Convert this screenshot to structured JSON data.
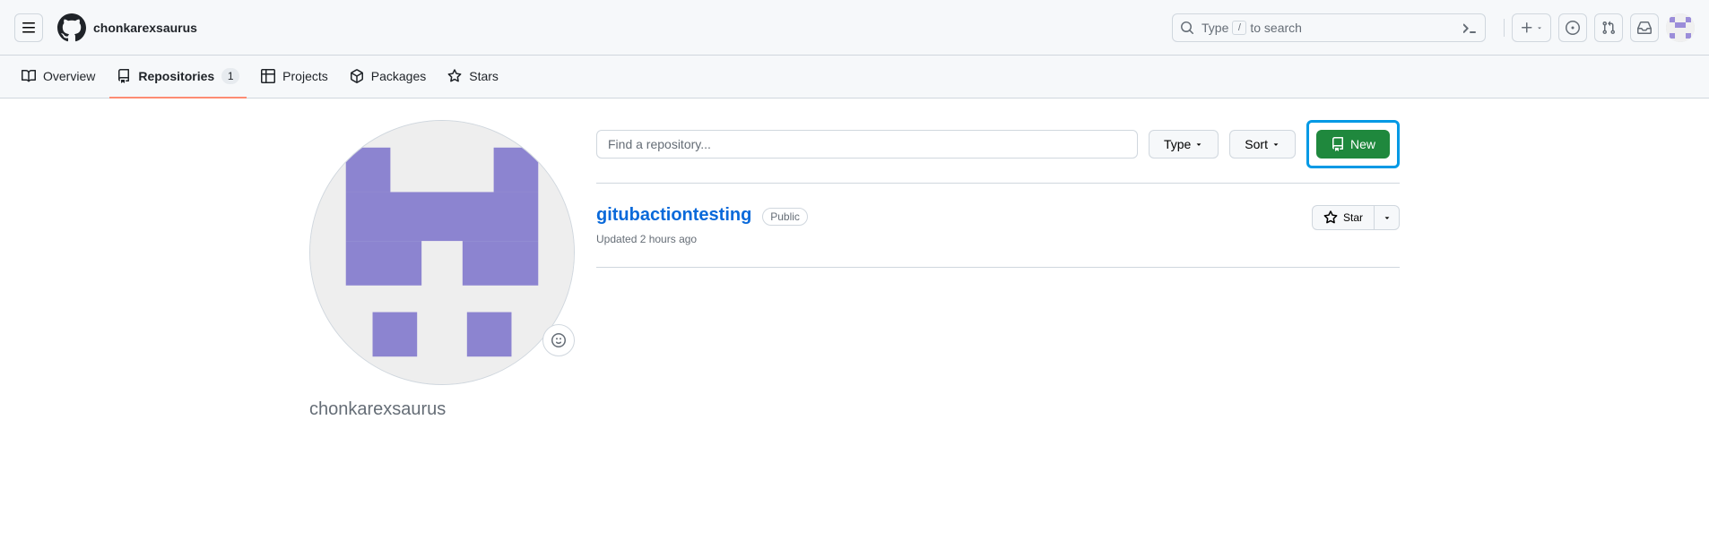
{
  "header": {
    "username": "chonkarexsaurus",
    "search_placeholder_before": "Type",
    "search_kbd": "/",
    "search_placeholder_after": "to search"
  },
  "tabs": {
    "overview": "Overview",
    "repositories": "Repositories",
    "repositories_count": "1",
    "projects": "Projects",
    "packages": "Packages",
    "stars": "Stars"
  },
  "sidebar": {
    "username": "chonkarexsaurus"
  },
  "toolbar": {
    "find_placeholder": "Find a repository...",
    "type_label": "Type",
    "sort_label": "Sort",
    "new_label": "New"
  },
  "repos": [
    {
      "name": "gitubactiontesting",
      "visibility": "Public",
      "updated": "Updated 2 hours ago",
      "star_label": "Star"
    }
  ]
}
